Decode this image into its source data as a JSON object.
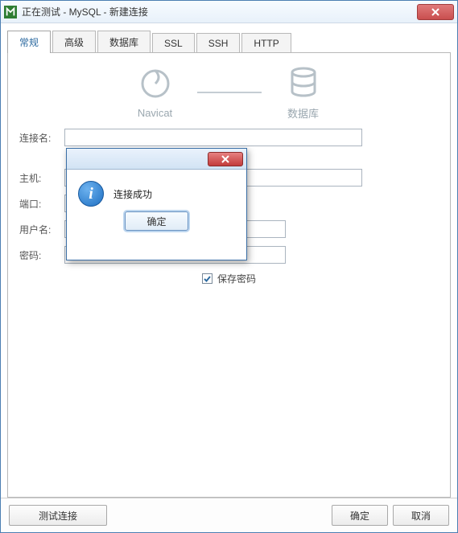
{
  "window": {
    "title": "正在测试 - MySQL - 新建连接"
  },
  "tabs": [
    {
      "label": "常规",
      "active": true
    },
    {
      "label": "高级",
      "active": false
    },
    {
      "label": "数据库",
      "active": false
    },
    {
      "label": "SSL",
      "active": false
    },
    {
      "label": "SSH",
      "active": false
    },
    {
      "label": "HTTP",
      "active": false
    }
  ],
  "diagram": {
    "left_label": "Navicat",
    "right_label": "数据库"
  },
  "form": {
    "connection_name_label": "连接名:",
    "connection_name_value": "",
    "host_label": "主机:",
    "host_value": "",
    "port_label": "端口:",
    "port_value": "",
    "username_label": "用户名:",
    "username_value": "",
    "password_label": "密码:",
    "password_value": "",
    "save_password_label": "保存密码",
    "save_password_checked": true
  },
  "modal": {
    "message": "连接成功",
    "ok_label": "确定"
  },
  "footer": {
    "test_label": "测试连接",
    "ok_label": "确定",
    "cancel_label": "取消"
  }
}
